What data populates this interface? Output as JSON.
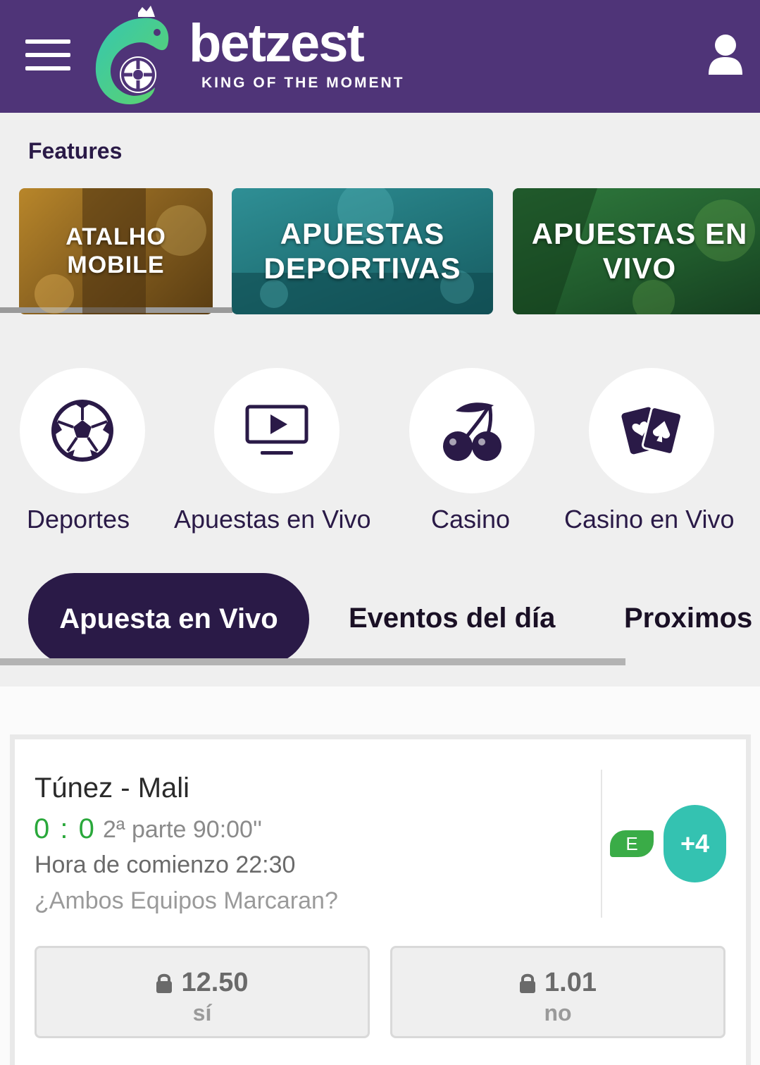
{
  "header": {
    "brand_name": "betzest",
    "brand_tagline": "KING OF THE MOMENT",
    "menu_icon": "hamburger-menu-icon",
    "logo_icon": "chameleon-logo-icon",
    "user_icon": "user-icon",
    "background_color": "#4f3478"
  },
  "features": {
    "title": "Features",
    "cards": [
      {
        "label_line1": "ATALHO",
        "label_line2": "MOBILE",
        "theme_color": "#b8862a"
      },
      {
        "label_line1": "APUESTAS",
        "label_line2": "DEPORTIVAS",
        "theme_color": "#2f8f95"
      },
      {
        "label_line1": "APUESTAS EN",
        "label_line2": "VIVO",
        "theme_color": "#2f7a3d"
      }
    ]
  },
  "quick_links": [
    {
      "label": "Deportes",
      "icon": "soccer-ball-icon"
    },
    {
      "label": "Apuestas en Vivo",
      "icon": "monitor-play-icon"
    },
    {
      "label": "Casino",
      "icon": "cherries-icon"
    },
    {
      "label": "Casino en Vivo",
      "icon": "playing-cards-icon"
    }
  ],
  "tabs": {
    "active": "Apuesta en Vivo",
    "items": [
      "Apuesta en Vivo",
      "Eventos del día",
      "Proximos"
    ]
  },
  "event": {
    "match": "Túnez - Mali",
    "score": "0 : 0",
    "period": "2ª parte 90:00''",
    "start_time": "Hora de comienzo 22:30",
    "market": "¿Ambos Equipos Marcaran?",
    "badge": "E",
    "more_markets": "+4",
    "odds": [
      {
        "value": "12.50",
        "label": "sí",
        "icon": "lock-icon"
      },
      {
        "value": "1.01",
        "label": "no",
        "icon": "lock-icon"
      }
    ]
  },
  "colors": {
    "primary_dark": "#2a1a47",
    "accent_teal": "#34c2b1",
    "score_green": "#2aa83b"
  }
}
